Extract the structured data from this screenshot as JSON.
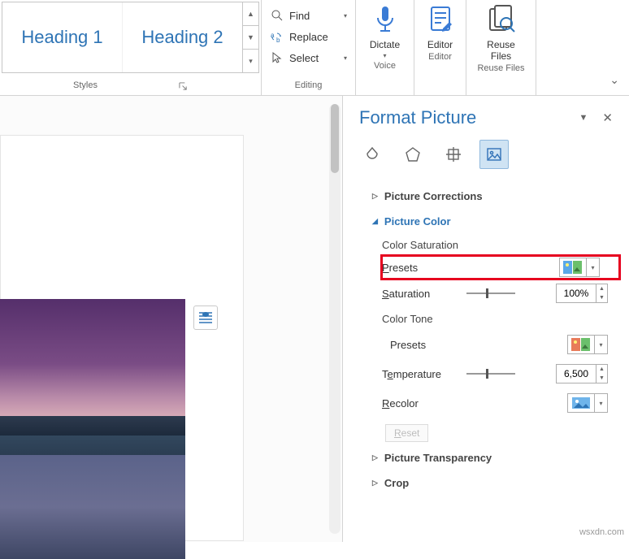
{
  "ribbon": {
    "styles": {
      "label": "Styles",
      "items": [
        "Heading 1",
        "Heading 2"
      ]
    },
    "editing": {
      "label": "Editing",
      "find": "Find",
      "replace": "Replace",
      "select": "Select"
    },
    "voice": {
      "label": "Voice",
      "button": "Dictate"
    },
    "editor": {
      "label": "Editor",
      "button": "Editor"
    },
    "reuse": {
      "label": "Reuse Files",
      "button": "Reuse\nFiles"
    }
  },
  "pane": {
    "title": "Format Picture",
    "sections": {
      "corrections": "Picture Corrections",
      "color": {
        "title": "Picture Color",
        "sat_head": "Color Saturation",
        "presets": "Presets",
        "saturation": "Saturation",
        "sat_value": "100%",
        "tone_head": "Color Tone",
        "tone_presets": "Presets",
        "temperature": "Temperature",
        "temp_value": "6,500",
        "recolor": "Recolor",
        "reset": "Reset"
      },
      "transparency": "Picture Transparency",
      "crop": "Crop"
    }
  },
  "watermark": "wsxdn.com"
}
